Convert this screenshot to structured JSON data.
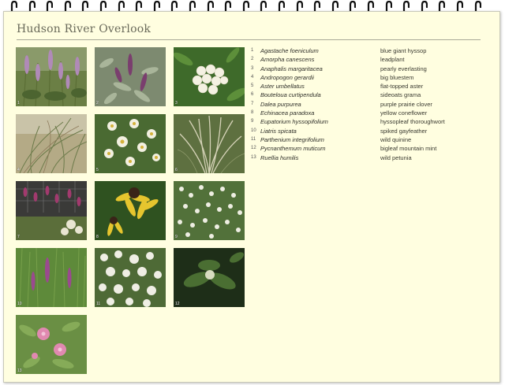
{
  "page": {
    "title": "Hudson River Overlook"
  },
  "photos": [
    {
      "label": "1"
    },
    {
      "label": "2"
    },
    {
      "label": "3"
    },
    {
      "label": "4"
    },
    {
      "label": "5"
    },
    {
      "label": "6"
    },
    {
      "label": "7"
    },
    {
      "label": "8"
    },
    {
      "label": "9"
    },
    {
      "label": "10"
    },
    {
      "label": "11"
    },
    {
      "label": "12"
    },
    {
      "label": "13"
    }
  ],
  "plants": [
    {
      "num": "1",
      "scientific": "Agastache foeniculum",
      "common": "blue giant hyssop"
    },
    {
      "num": "2",
      "scientific": "Amorpha canescens",
      "common": "leadplant"
    },
    {
      "num": "3",
      "scientific": "Anaphalis margaritacea",
      "common": "pearly everlasting"
    },
    {
      "num": "4",
      "scientific": "Andropogon gerardii",
      "common": "big bluestem"
    },
    {
      "num": "5",
      "scientific": "Aster umbellatus",
      "common": "flat-topped aster"
    },
    {
      "num": "6",
      "scientific": "Bouteloua curtipendula",
      "common": "sideoats grama"
    },
    {
      "num": "7",
      "scientific": "Dalea purpurea",
      "common": "purple prairie clover"
    },
    {
      "num": "8",
      "scientific": "Echinacea paradoxa",
      "common": "yellow coneflower"
    },
    {
      "num": "9",
      "scientific": "Eupatorium hyssopifolium",
      "common": "hyssopleaf thoroughwort"
    },
    {
      "num": "10",
      "scientific": "Liatris spicata",
      "common": "spiked gayfeather"
    },
    {
      "num": "11",
      "scientific": "Parthenium integrifolium",
      "common": "wild quinine"
    },
    {
      "num": "12",
      "scientific": "Pycnanthemum muticum",
      "common": "bigleaf mountain mint"
    },
    {
      "num": "13",
      "scientific": "Ruellia humilis",
      "common": "wild petunia"
    }
  ]
}
